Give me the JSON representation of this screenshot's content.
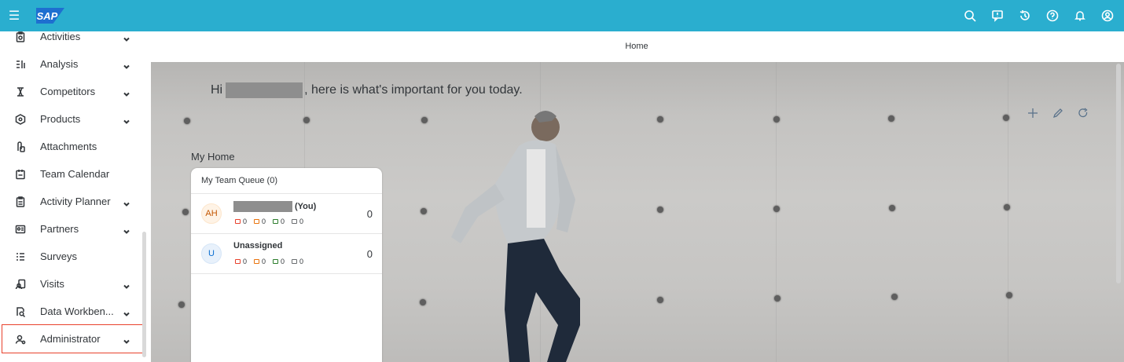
{
  "shell": {
    "logo": "SAP",
    "icons": [
      "search-icon",
      "feedback-icon",
      "history-icon",
      "help-icon",
      "notifications-icon",
      "user-icon"
    ]
  },
  "sidebar": {
    "items": [
      {
        "label": "Activities",
        "icon": "clipboard-icon",
        "expandable": true
      },
      {
        "label": "Analysis",
        "icon": "analysis-icon",
        "expandable": true
      },
      {
        "label": "Competitors",
        "icon": "competitor-icon",
        "expandable": true
      },
      {
        "label": "Products",
        "icon": "product-icon",
        "expandable": true
      },
      {
        "label": "Attachments",
        "icon": "attachment-icon",
        "expandable": false
      },
      {
        "label": "Team Calendar",
        "icon": "calendar-icon",
        "expandable": false
      },
      {
        "label": "Activity Planner",
        "icon": "planner-icon",
        "expandable": true
      },
      {
        "label": "Partners",
        "icon": "partner-icon",
        "expandable": true
      },
      {
        "label": "Surveys",
        "icon": "survey-icon",
        "expandable": false
      },
      {
        "label": "Visits",
        "icon": "visit-icon",
        "expandable": true
      },
      {
        "label": "Data Workben...",
        "icon": "data-workbench-icon",
        "expandable": true
      },
      {
        "label": "Administrator",
        "icon": "administrator-icon",
        "expandable": true,
        "selected": true
      }
    ]
  },
  "page": {
    "title": "Home",
    "greeting_prefix": "Hi",
    "greeting_suffix": ", here is what's important for you today.",
    "section_label": "My Home"
  },
  "card": {
    "title": "My Team Queue (0)",
    "rows": [
      {
        "initials": "AH",
        "name_suffix": "(You)",
        "counts": [
          "0",
          "0",
          "0",
          "0"
        ],
        "total": "0"
      },
      {
        "initials": "U",
        "name": "Unassigned",
        "counts": [
          "0",
          "0",
          "0",
          "0"
        ],
        "total": "0"
      }
    ],
    "stat_colors": [
      "#e8412c",
      "#e9730c",
      "#2b7d2b",
      "#6a6d70"
    ]
  },
  "colors": {
    "shell": "#2aaecf",
    "selected_outline": "#e8412c"
  }
}
